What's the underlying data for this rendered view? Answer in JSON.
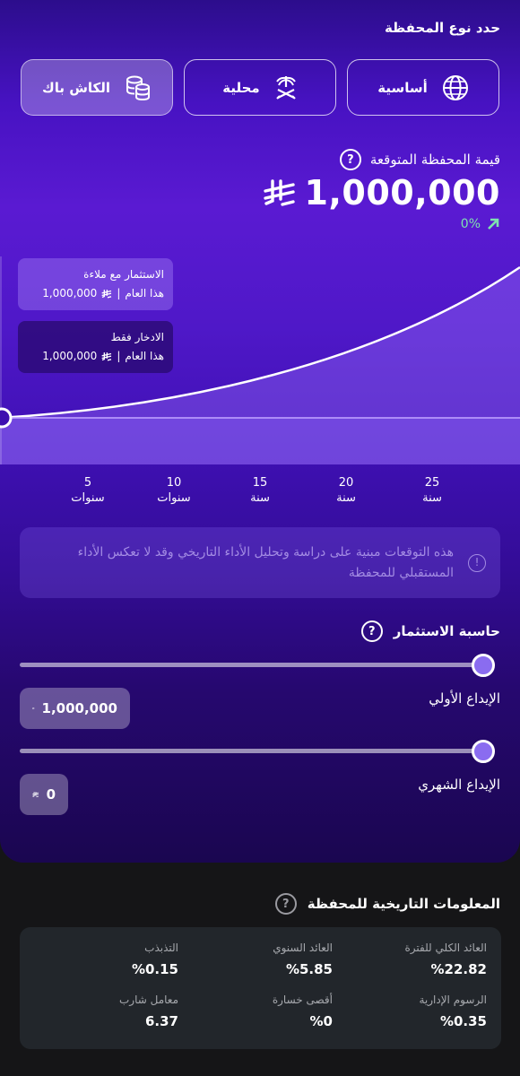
{
  "portfolio_type": {
    "title": "حدد نوع المحفظة",
    "options": [
      {
        "label": "أساسية",
        "icon": "globe-icon",
        "selected": false
      },
      {
        "label": "محلية",
        "icon": "palm-swords-icon",
        "selected": false
      },
      {
        "label": "الكاش باك",
        "icon": "coins-stack-icon",
        "selected": true
      }
    ]
  },
  "expected_value": {
    "label": "قيمة المحفظة المتوقعة",
    "amount": "1,000,000",
    "currency_icon": "riyal-icon",
    "change": "0%",
    "change_icon": "arrow-up-right-icon"
  },
  "chart_tooltips": {
    "invest": {
      "title": "الاستثمار مع ملاءة",
      "amount": "1,000,000",
      "period": "هذا العام"
    },
    "save": {
      "title": "الادخار فقط",
      "amount": "1,000,000",
      "period": "هذا العام"
    },
    "separator": "|"
  },
  "x_axis": [
    {
      "num": "5",
      "unit": "سنوات"
    },
    {
      "num": "10",
      "unit": "سنوات"
    },
    {
      "num": "15",
      "unit": "سنة"
    },
    {
      "num": "20",
      "unit": "سنة"
    },
    {
      "num": "25",
      "unit": "سنة"
    }
  ],
  "disclaimer": "هذه التوقعات مبنية على دراسة وتحليل الأداء التاريخي وقد لا تعكس الأداء المستقبلي للمحفظة",
  "calculator": {
    "title": "حاسبة الاستثمار",
    "initial_deposit": {
      "label": "الإيداع الأولي",
      "value": "1,000,000",
      "level": 1.0
    },
    "monthly_deposit": {
      "label": "الإيداع الشهري",
      "value": "0",
      "level": 1.0
    }
  },
  "history": {
    "title": "المعلومات التاريخية للمحفظة",
    "stats": [
      {
        "label": "العائد الكلي للفترة",
        "value": "%22.82"
      },
      {
        "label": "العائد السنوي",
        "value": "%5.85"
      },
      {
        "label": "التذبذب",
        "value": "%0.15"
      },
      {
        "label": "الرسوم الإدارية",
        "value": "%0.35"
      },
      {
        "label": "أقصى خسارة",
        "value": "%0"
      },
      {
        "label": "معامل شارب",
        "value": "6.37"
      }
    ]
  },
  "colors": {
    "accent": "#5a1ad2",
    "positive": "#7fe3b0",
    "slider_thumb": "#8a6cf0",
    "card_dark": "#22262b"
  }
}
